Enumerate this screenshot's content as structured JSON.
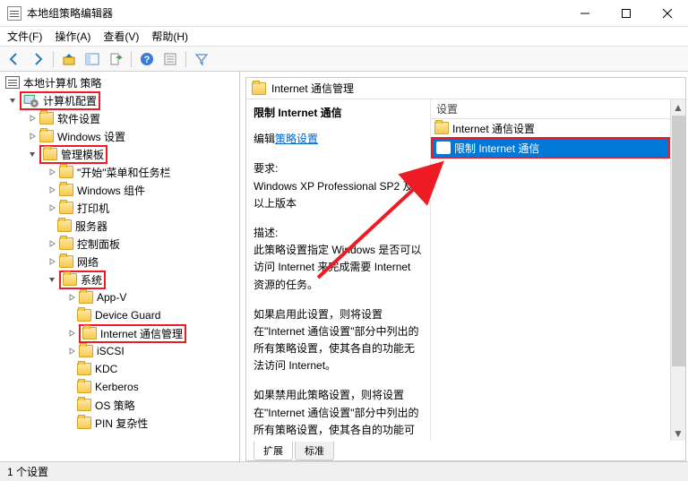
{
  "title": "本地组策略编辑器",
  "menu": {
    "file": "文件(F)",
    "action": "操作(A)",
    "view": "查看(V)",
    "help": "帮助(H)"
  },
  "tree": {
    "root": "本地计算机 策略",
    "computer_config": "计算机配置",
    "software_settings": "软件设置",
    "windows_settings": "Windows 设置",
    "admin_templates": "管理模板",
    "start_menu": "\"开始\"菜单和任务栏",
    "windows_components": "Windows 组件",
    "printers": "打印机",
    "servers": "服务器",
    "control_panel": "控制面板",
    "network": "网络",
    "system": "系统",
    "appv": "App-V",
    "device_guard": "Device Guard",
    "internet_comm_mgmt": "Internet 通信管理",
    "iscsi": "iSCSI",
    "kdc": "KDC",
    "kerberos": "Kerberos",
    "os_policy": "OS 策略",
    "pin_complexity": "PIN 复杂性"
  },
  "content_header": "Internet 通信管理",
  "desc": {
    "title": "限制 Internet 通信",
    "edit_prefix": "编辑",
    "edit_link": "策略设置",
    "req_label": "要求:",
    "req_text": "Windows XP Professional SP2 及以上版本",
    "desc_label": "描述:",
    "p1": "此策略设置指定 Windows 是否可以访问 Internet 来完成需要 Internet 资源的任务。",
    "p2": "如果启用此设置，则将设置在\"Internet 通信设置\"部分中列出的所有策略设置，使其各自的功能无法访问 Internet。",
    "p3": "如果禁用此策略设置，则将设置在\"Internet 通信设置\"部分中列出的所有策略设置，使其各自的功能可"
  },
  "list": {
    "header": "设置",
    "row1": "Internet 通信设置",
    "row2": "限制 Internet 通信"
  },
  "tabs": {
    "extended": "扩展",
    "standard": "标准"
  },
  "status": "1 个设置"
}
